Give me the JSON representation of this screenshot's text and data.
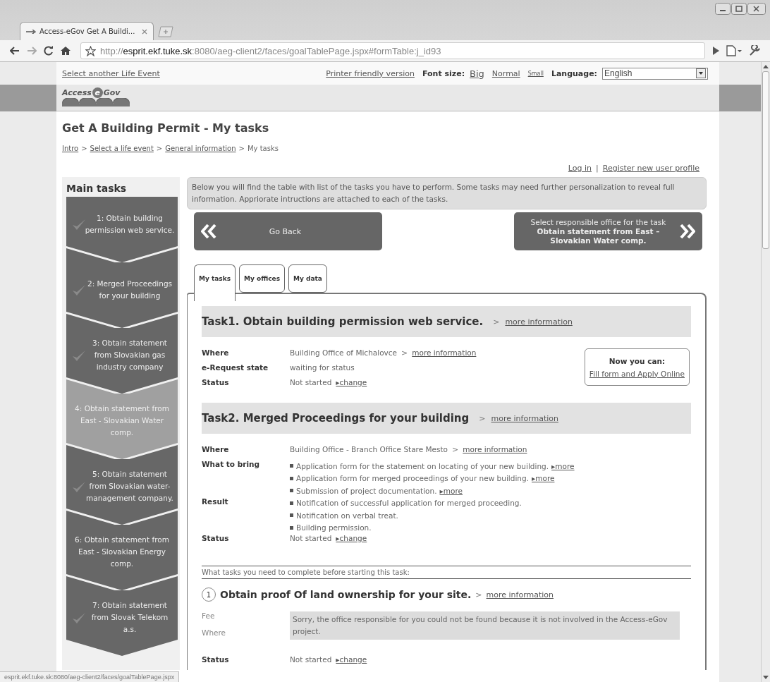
{
  "browser": {
    "tab": {
      "title": "Access-eGov Get A Buildi...",
      "selected": true
    },
    "url": {
      "scheme": "http://",
      "host": "esprit.ekf.tuke.sk",
      "path": ":8080/aeg-client2/faces/goalTablePage.jspx#formTable:j_id93"
    },
    "status_url": "esprit.ekf.tuke.sk:8080/aeg-client2/faces/goalTablePage.jspx"
  },
  "toolbar": {
    "life_event_link": "Select another Life Event",
    "printer_link": "Printer friendly version",
    "font_size_label": "Font size:",
    "font_sizes": [
      {
        "label": "Big",
        "kind": "big"
      },
      {
        "label": "Normal",
        "kind": "normal"
      },
      {
        "label": "Small",
        "kind": "small"
      }
    ],
    "language_label": "Language:",
    "language": "English"
  },
  "logo": {
    "left": "Access",
    "mark": "e",
    "right": "Gov"
  },
  "title": "Get A Building Permit - My tasks",
  "breadcrumb": {
    "separator": ">",
    "items": [
      {
        "label": "Intro",
        "link": true
      },
      {
        "label": "Select a life event",
        "link": true
      },
      {
        "label": "General information",
        "link": true
      },
      {
        "label": "My tasks",
        "link": false
      }
    ]
  },
  "user_links": {
    "separator": "|",
    "items": [
      "Log in",
      "Register new user profile"
    ]
  },
  "sidebar": {
    "title": "Main tasks",
    "items": [
      {
        "label": "1: Obtain building permission web service.",
        "done": true,
        "selected": false
      },
      {
        "label": "2: Merged Proceedings for your building",
        "done": true,
        "selected": false
      },
      {
        "label": "3: Obtain statement from Slovakian gas industry company",
        "done": true,
        "selected": false
      },
      {
        "label": "4: Obtain statement from East - Slovakian Water comp.",
        "done": false,
        "selected": true
      },
      {
        "label": "5: Obtain statement from Slovakian water-management company.",
        "done": true,
        "selected": false
      },
      {
        "label": "6: Obtain statement from East - Slovakian Energy comp.",
        "done": false,
        "selected": false
      },
      {
        "label": "7: Obtain statement from Slovak Telekom a.s.",
        "done": true,
        "selected": false
      }
    ]
  },
  "info": "Below you will find the table with list of the tasks you have to perform. Some tasks may need further personalization to reveal full information. Appriorate intructions are attached to each of the tasks.",
  "nav": {
    "back": "Go Back",
    "next": "Select responsible office for the task **Obtain statement from East – Slovakian Water comp.**"
  },
  "tabs": [
    {
      "label": "My tasks",
      "selected": true
    },
    {
      "label": "My offices",
      "selected": false
    },
    {
      "label": "My data",
      "selected": false
    }
  ],
  "tasks": [
    {
      "title": "Task1. Obtain building permission web service.",
      "link_prefix": ">",
      "link": "more information",
      "action_box": {
        "title": "Now you can:",
        "link": "Fill form and Apply Online"
      },
      "rows": [
        {
          "label": "Where",
          "kind": "text",
          "value": "Building Office of Michalovce",
          "link_prefix": ">",
          "link": "more information"
        },
        {
          "label": "e-Request state",
          "kind": "text",
          "value": "waiting for status"
        },
        {
          "label": "Status",
          "kind": "text",
          "value": "Not started",
          "link": "▸change"
        }
      ]
    },
    {
      "title": "Task2. Merged Proceedings for your building",
      "link_prefix": ">",
      "link": "more information",
      "rows": [
        {
          "label": "Where",
          "kind": "text",
          "value": "Building Office - Branch Office Stare Mesto",
          "link_prefix": ">",
          "link": "more information"
        },
        {
          "label": "What to bring",
          "kind": "list",
          "items": [
            {
              "text": "Application form for the statement on locating of your new building.",
              "link": "▸more"
            },
            {
              "text": "Application form for merged proceedings of your new building.",
              "link": "▸more"
            },
            {
              "text": "Submission of project documentation.",
              "link": "▸more"
            }
          ]
        },
        {
          "label": "Result",
          "kind": "list",
          "items": [
            {
              "text": "Notification of successful application for merged proceeding."
            },
            {
              "text": "Notification on verbal treat."
            },
            {
              "text": "Building permission."
            }
          ]
        },
        {
          "label": "Status",
          "kind": "text",
          "value": "Not started",
          "link": "▸change"
        }
      ],
      "prerequisites": {
        "heading": "What tasks you need to complete before starting this task:",
        "items": [
          {
            "number": "1",
            "title": "Obtain proof Of land ownership for your site.",
            "link_prefix": ">",
            "link": "more information",
            "labels": [
              "Fee",
              "Where"
            ],
            "notice": "Sorry, the office responsible for you could not be found because it is not involved in the Access-eGov project.",
            "status_label": "Status",
            "status": "Not started",
            "status_link": "▸change"
          }
        ]
      }
    }
  ]
}
